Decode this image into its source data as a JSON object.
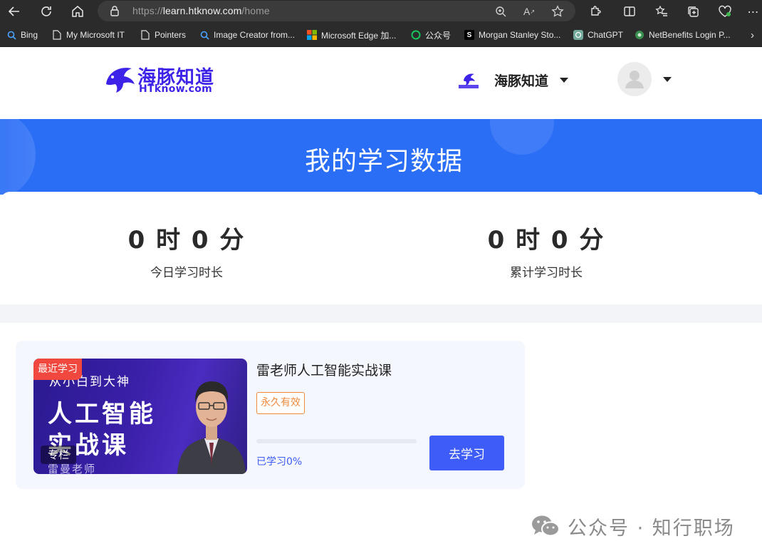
{
  "browser": {
    "url_prefix": "https://",
    "url_host": "learn.htknow.com",
    "url_path": "/home",
    "bookmarks": [
      {
        "label": "Bing",
        "icon": "bing-search-icon"
      },
      {
        "label": "My Microsoft IT",
        "icon": "page-icon"
      },
      {
        "label": "Pointers",
        "icon": "page-icon"
      },
      {
        "label": "Image Creator from...",
        "icon": "search-icon"
      },
      {
        "label": "Microsoft Edge 加...",
        "icon": "microsoft-logo-icon"
      },
      {
        "label": "公众号",
        "icon": "wechat-logo-icon"
      },
      {
        "label": "Morgan Stanley Sto...",
        "icon": "morgan-stanley-icon"
      },
      {
        "label": "ChatGPT",
        "icon": "chatgpt-icon"
      },
      {
        "label": "NetBenefits Login P...",
        "icon": "netbenefits-icon"
      }
    ]
  },
  "header": {
    "logo_cn": "海豚知道",
    "logo_en": "HTknow.com",
    "org_name": "海豚知道"
  },
  "banner": {
    "title": "我的学习数据"
  },
  "stats": {
    "today_value": "0 时 0 分",
    "today_label": "今日学习时长",
    "total_value": "0 时 0 分",
    "total_label": "累计学习时长"
  },
  "course": {
    "tag": "最近学习",
    "thumb_subtitle": "从小白到大神",
    "thumb_title_1": "人工智能",
    "thumb_title_2": "实战课",
    "thumb_column": "专栏",
    "thumb_teacher": "雷曼老师",
    "title": "雷老师人工智能实战课",
    "validity": "永久有效",
    "progress": 0,
    "progress_text": "已学习0%",
    "button": "去学习"
  },
  "watermark": {
    "text": "公众号 · 知行职场"
  },
  "colors": {
    "brand": "#3d23e8",
    "banner": "#2b6ef6",
    "accent": "#3e5cf7",
    "badge": "#f08a3c",
    "tag": "#f0483e"
  }
}
